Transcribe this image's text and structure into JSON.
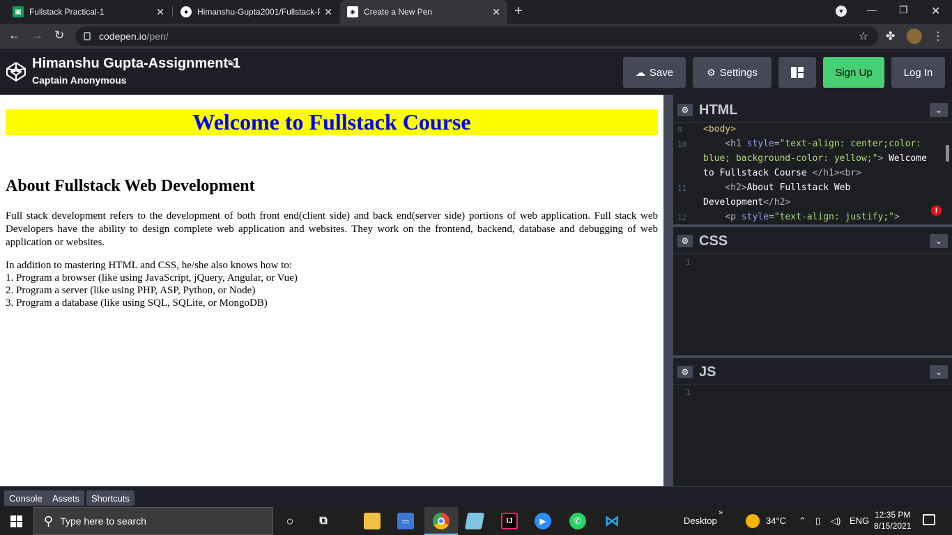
{
  "browser": {
    "tabs": [
      {
        "title": "Fullstack Practical-1",
        "icon": "google-classroom-icon",
        "active": false
      },
      {
        "title": "Himanshu-Gupta2001/Fullstack-P",
        "icon": "github-icon",
        "active": false
      },
      {
        "title": "Create a New Pen",
        "icon": "codepen-icon",
        "active": true
      }
    ],
    "url_host": "codepen.io",
    "url_path": "/pen/"
  },
  "codepen": {
    "title": "Himanshu Gupta-Assignment-1",
    "author": "Captain Anonymous",
    "buttons": {
      "save": "Save",
      "settings": "Settings",
      "signup": "Sign Up",
      "login": "Log In"
    },
    "bottom_buttons": [
      "Console",
      "Assets",
      "Shortcuts"
    ]
  },
  "preview": {
    "h1": "Welcome to Fullstack Course",
    "h2": "About Fullstack Web Development",
    "p1": "Full stack development refers to the development of both front end(client side) and back end(server side) portions of web application. Full stack web Developers have the ability to design complete web application and websites. They work on the frontend, backend, database and debugging of web application or websites.",
    "p2_intro": "In addition to mastering HTML and CSS, he/she also knows how to:",
    "p2_items": [
      "1. Program a browser (like using JavaScript, jQuery, Angular, or Vue)",
      "2. Program a server (like using PHP, ASP, Python, or Node)",
      "3. Program a database (like using SQL, SQLite, or MongoDB)"
    ]
  },
  "editors": {
    "html_label": "HTML",
    "css_label": "CSS",
    "js_label": "JS",
    "html_line_numbers": [
      "9",
      "10",
      "11",
      "12"
    ],
    "css_line_numbers": [
      "1"
    ],
    "js_line_numbers": [
      "1"
    ]
  },
  "taskbar": {
    "search_placeholder": "Type here to search",
    "desktop_label": "Desktop",
    "temperature": "34°C",
    "language": "ENG",
    "time": "12:35 PM",
    "date": "8/15/2021"
  }
}
